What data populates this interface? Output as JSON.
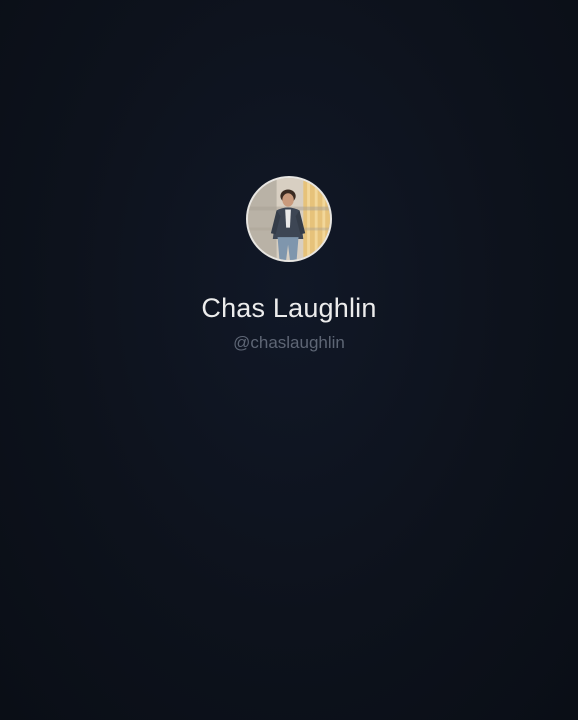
{
  "profile": {
    "name": "Chas Laughlin",
    "handle": "@chaslaughlin",
    "avatar_icon": "profile-photo"
  },
  "colors": {
    "background": "#0d121c",
    "name_text": "#ececec",
    "handle_text": "#5e6675",
    "avatar_border": "#e8e6e2"
  }
}
